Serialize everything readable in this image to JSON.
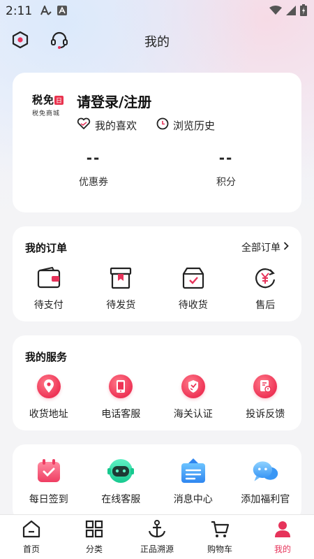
{
  "status_bar": {
    "time": "2:11",
    "left_icons": [
      "font-a-icon",
      "a-square-icon"
    ],
    "right_icons": [
      "wifi-icon",
      "signal-icon",
      "battery-charging-icon"
    ]
  },
  "top_bar": {
    "title": "我的",
    "left_icons": [
      "settings-hex-icon",
      "headset-icon"
    ]
  },
  "profile": {
    "logo": {
      "text": "税免",
      "badge": "日",
      "subtext": "税免商城"
    },
    "login_text": "请登录/注册",
    "links": [
      {
        "label": "我的喜欢",
        "icon": "heart-icon"
      },
      {
        "label": "浏览历史",
        "icon": "clock-icon"
      }
    ],
    "stats": [
      {
        "value": "--",
        "label": "优惠券"
      },
      {
        "value": "--",
        "label": "积分"
      }
    ]
  },
  "orders": {
    "title": "我的订单",
    "all_label": "全部订单",
    "items": [
      {
        "label": "待支付",
        "icon": "wallet-icon"
      },
      {
        "label": "待发货",
        "icon": "package-icon"
      },
      {
        "label": "待收货",
        "icon": "box-check-icon"
      },
      {
        "label": "售后",
        "icon": "yen-refresh-icon"
      }
    ]
  },
  "services": {
    "title": "我的服务",
    "items": [
      {
        "label": "收货地址",
        "icon": "location-pin-icon"
      },
      {
        "label": "电话客服",
        "icon": "phone-icon"
      },
      {
        "label": "海关认证",
        "icon": "shield-icon"
      },
      {
        "label": "投诉反馈",
        "icon": "feedback-icon"
      }
    ]
  },
  "extras": {
    "items": [
      {
        "label": "每日签到",
        "icon": "calendar-check-icon"
      },
      {
        "label": "在线客服",
        "icon": "robot-icon"
      },
      {
        "label": "消息中心",
        "icon": "message-board-icon"
      },
      {
        "label": "添加福利官",
        "icon": "chat-bubbles-icon"
      }
    ]
  },
  "tab_bar": {
    "items": [
      {
        "label": "首页",
        "icon": "home-icon"
      },
      {
        "label": "分类",
        "icon": "grid-icon"
      },
      {
        "label": "正品溯源",
        "icon": "anchor-icon"
      },
      {
        "label": "购物车",
        "icon": "cart-icon"
      },
      {
        "label": "我的",
        "icon": "user-icon"
      }
    ],
    "active": "我的"
  },
  "colors": {
    "accent": "#e6335a",
    "background": "#f4f4f6",
    "card": "#ffffff"
  }
}
